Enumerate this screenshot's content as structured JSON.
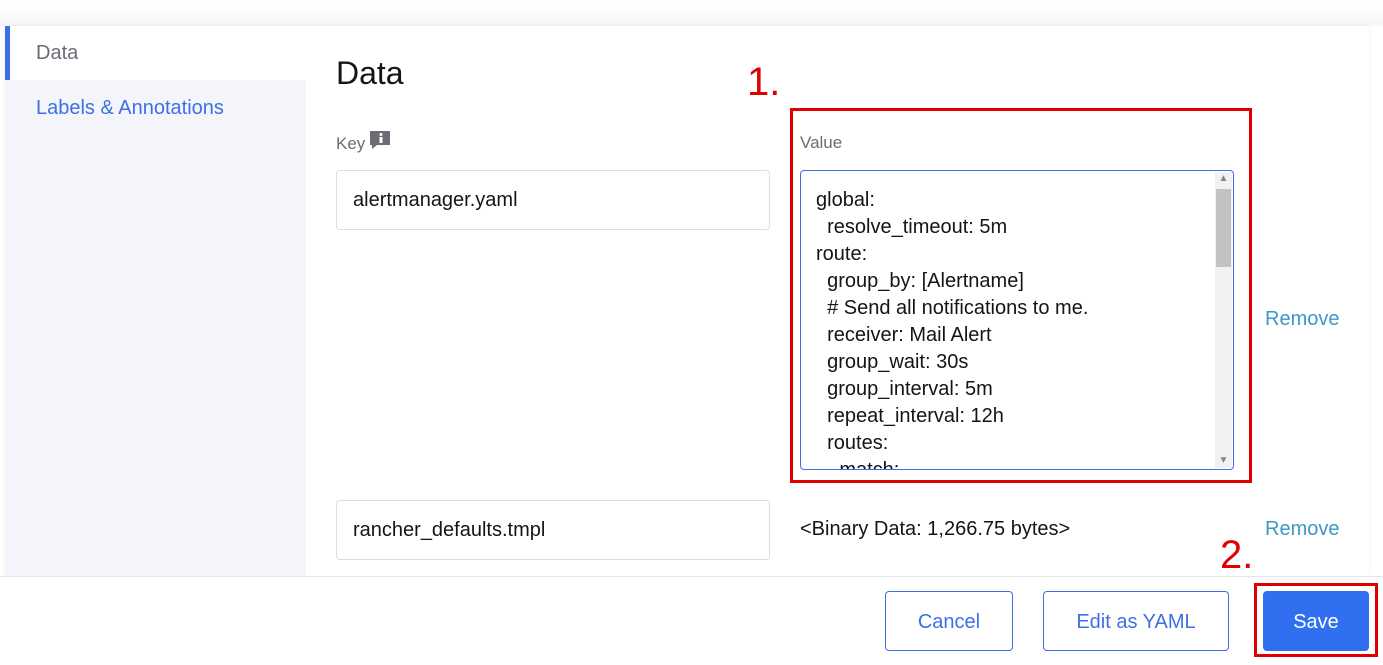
{
  "sidebar": {
    "items": [
      {
        "label": "Data"
      },
      {
        "label": "Labels & Annotations"
      }
    ]
  },
  "main": {
    "title": "Data",
    "key_label": "Key",
    "value_label": "Value",
    "entries": [
      {
        "key": "alertmanager.yaml",
        "value_lines": [
          "global:",
          "  resolve_timeout: 5m",
          "route:",
          "  group_by: [Alertname]",
          "  # Send all notifications to me.",
          "  receiver: Mail Alert",
          "  group_wait: 30s",
          "  group_interval: 5m",
          "  repeat_interval: 12h",
          "  routes:",
          "  - match:"
        ],
        "remove_label": "Remove"
      },
      {
        "key": "rancher_defaults.tmpl",
        "value": "<Binary Data: 1,266.75 bytes>",
        "remove_label": "Remove"
      }
    ]
  },
  "footer": {
    "cancel_label": "Cancel",
    "edit_yaml_label": "Edit as YAML",
    "save_label": "Save"
  },
  "annotations": {
    "step1": "1.",
    "step2": "2."
  },
  "colors": {
    "accent": "#3d6fe6",
    "primary_button": "#2f6ff0",
    "annotation_red": "#e00000",
    "remove_link": "#3d98c8"
  },
  "icons": [
    "info-icon",
    "scroll-up-arrow-icon",
    "scroll-down-arrow-icon"
  ]
}
